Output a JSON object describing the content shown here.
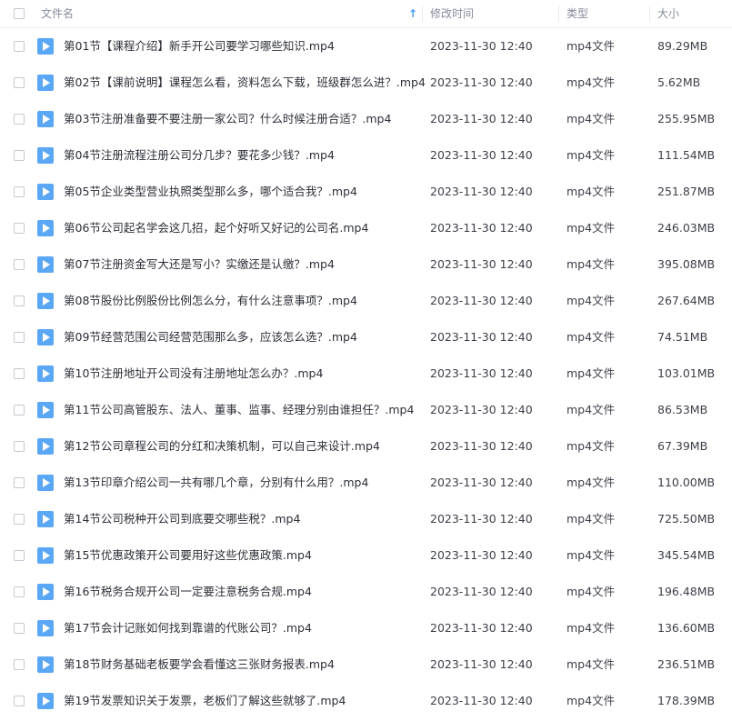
{
  "header": {
    "name": "文件名",
    "sort_indicator": "↑",
    "modified": "修改时间",
    "type": "类型",
    "size": "大小"
  },
  "icons": {
    "file": "video-file-icon",
    "file_color": "#5aa7f5",
    "sort": "sort-ascending-icon",
    "sort_color": "#3b9cff"
  },
  "files": [
    {
      "name": "第01节【课程介绍】新手开公司要学习哪些知识.mp4",
      "modified": "2023-11-30 12:40",
      "type": "mp4文件",
      "size": "89.29MB"
    },
    {
      "name": "第02节【课前说明】课程怎么看，资料怎么下载，班级群怎么进？.mp4",
      "modified": "2023-11-30 12:40",
      "type": "mp4文件",
      "size": "5.62MB"
    },
    {
      "name": "第03节注册准备要不要注册一家公司？什么时候注册合适？.mp4",
      "modified": "2023-11-30 12:40",
      "type": "mp4文件",
      "size": "255.95MB"
    },
    {
      "name": "第04节注册流程注册公司分几步？要花多少钱？.mp4",
      "modified": "2023-11-30 12:40",
      "type": "mp4文件",
      "size": "111.54MB"
    },
    {
      "name": "第05节企业类型营业执照类型那么多，哪个适合我？.mp4",
      "modified": "2023-11-30 12:40",
      "type": "mp4文件",
      "size": "251.87MB"
    },
    {
      "name": "第06节公司起名学会这几招，起个好听又好记的公司名.mp4",
      "modified": "2023-11-30 12:40",
      "type": "mp4文件",
      "size": "246.03MB"
    },
    {
      "name": "第07节注册资金写大还是写小？实缴还是认缴？.mp4",
      "modified": "2023-11-30 12:40",
      "type": "mp4文件",
      "size": "395.08MB"
    },
    {
      "name": "第08节股份比例股份比例怎么分，有什么注意事项？.mp4",
      "modified": "2023-11-30 12:40",
      "type": "mp4文件",
      "size": "267.64MB"
    },
    {
      "name": "第09节经营范围公司经营范围那么多，应该怎么选？.mp4",
      "modified": "2023-11-30 12:40",
      "type": "mp4文件",
      "size": "74.51MB"
    },
    {
      "name": "第10节注册地址开公司没有注册地址怎么办？.mp4",
      "modified": "2023-11-30 12:40",
      "type": "mp4文件",
      "size": "103.01MB"
    },
    {
      "name": "第11节公司高管股东、法人、董事、监事、经理分别由谁担任？.mp4",
      "modified": "2023-11-30 12:40",
      "type": "mp4文件",
      "size": "86.53MB"
    },
    {
      "name": "第12节公司章程公司的分红和决策机制，可以自己来设计.mp4",
      "modified": "2023-11-30 12:40",
      "type": "mp4文件",
      "size": "67.39MB"
    },
    {
      "name": "第13节印章介绍公司一共有哪几个章，分别有什么用？.mp4",
      "modified": "2023-11-30 12:40",
      "type": "mp4文件",
      "size": "110.00MB"
    },
    {
      "name": "第14节公司税种开公司到底要交哪些税？.mp4",
      "modified": "2023-11-30 12:40",
      "type": "mp4文件",
      "size": "725.50MB"
    },
    {
      "name": "第15节优惠政策开公司要用好这些优惠政策.mp4",
      "modified": "2023-11-30 12:40",
      "type": "mp4文件",
      "size": "345.54MB"
    },
    {
      "name": "第16节税务合规开公司一定要注意税务合规.mp4",
      "modified": "2023-11-30 12:40",
      "type": "mp4文件",
      "size": "196.48MB"
    },
    {
      "name": "第17节会计记账如何找到靠谱的代账公司？.mp4",
      "modified": "2023-11-30 12:40",
      "type": "mp4文件",
      "size": "136.60MB"
    },
    {
      "name": "第18节财务基础老板要学会看懂这三张财务报表.mp4",
      "modified": "2023-11-30 12:40",
      "type": "mp4文件",
      "size": "236.51MB"
    },
    {
      "name": "第19节发票知识关于发票，老板们了解这些就够了.mp4",
      "modified": "2023-11-30 12:40",
      "type": "mp4文件",
      "size": "178.39MB"
    }
  ]
}
